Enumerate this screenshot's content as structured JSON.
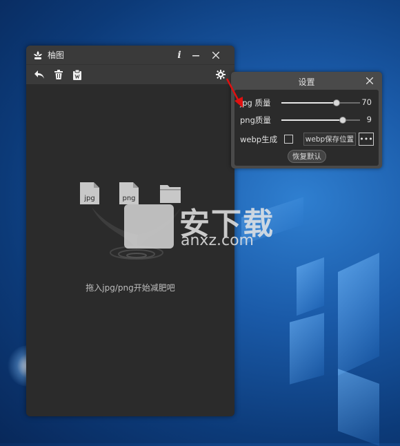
{
  "app": {
    "title": "柚图",
    "hint": "拖入jpg/png开始减肥吧",
    "file_icons": [
      {
        "name": "jpg-file-icon",
        "label": "jpg"
      },
      {
        "name": "png-file-icon",
        "label": "png"
      },
      {
        "name": "folder-icon",
        "label": ""
      }
    ],
    "colors": {
      "window": "#2b2b2b",
      "titlebar": "#3a3a3a"
    }
  },
  "settings": {
    "title": "设置",
    "jpg_label": "jpg 质量",
    "jpg_value": "70",
    "jpg_fraction": 0.7,
    "png_label": "png质量",
    "png_value": "9",
    "png_fraction": 0.78,
    "webp_label": "webp生成",
    "webp_checked": false,
    "webp_path_button": "webp保存位置",
    "more_button": "•••",
    "reset_button": "恢复默认"
  },
  "watermark": {
    "text": "安下载",
    "sub": "anxz.com"
  }
}
